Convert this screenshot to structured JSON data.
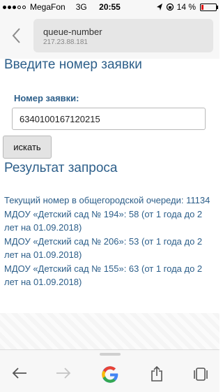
{
  "status_bar": {
    "carrier": "MegaFon",
    "network": "3G",
    "time": "20:55",
    "battery_percent_text": "14 %",
    "battery_level": 0.14,
    "battery_color": "#e11111"
  },
  "nav": {
    "back_icon": "chevron-left-icon",
    "page_title": "queue-number",
    "page_address": "217.23.88.181"
  },
  "form": {
    "heading": "Введите номер заявки",
    "field_label": "Номер заявки:",
    "field_value": "6340100167120215",
    "search_button": "искать"
  },
  "result": {
    "heading": "Результат запроса",
    "lines": [
      "Текущий номер в общегородской очереди: 11134",
      "МДОУ «Детский сад № 194»: 58 (от 1 года до 2 лет на 01.09.2018)",
      "МДОУ «Детский сад № 206»: 53 (от 1 года до 2 лет на 01.09.2018)",
      "МДОУ «Детский сад № 155»: 63 (от 1 года до 2 лет на 01.09.2018)"
    ]
  },
  "toolbar": {
    "icons": [
      "arrow-left-icon",
      "arrow-right-icon",
      "google-icon",
      "share-icon",
      "tabs-icon"
    ]
  },
  "colors": {
    "accent": "#2d5f8a",
    "google_blue": "#4285f4",
    "google_red": "#ea4335",
    "google_yellow": "#fbbc05",
    "google_green": "#34a853"
  }
}
